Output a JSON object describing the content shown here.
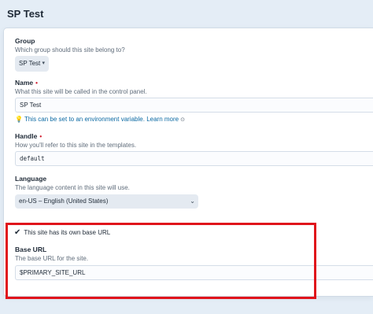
{
  "page": {
    "title": "SP Test"
  },
  "group": {
    "label": "Group",
    "instructions": "Which group should this site belong to?",
    "selected": "SP Test"
  },
  "name": {
    "label": "Name",
    "required_marker": "•",
    "instructions": "What this site will be called in the control panel.",
    "value": "SP Test",
    "hint_text": "This can be set to an environment variable.",
    "hint_link": "Learn more"
  },
  "handle": {
    "label": "Handle",
    "required_marker": "•",
    "instructions": "How you'll refer to this site in the templates.",
    "value": "default"
  },
  "language": {
    "label": "Language",
    "instructions": "The language content in this site will use.",
    "selected": "en-US – English (United States)"
  },
  "base_url_toggle": {
    "label": "This site has its own base URL",
    "checked": true
  },
  "base_url": {
    "label": "Base URL",
    "instructions": "The base URL for the site.",
    "value": "$PRIMARY_SITE_URL"
  },
  "colors": {
    "background": "#e4edf6",
    "required": "#cf1124",
    "link": "#0b69a3",
    "highlight": "#e0141b"
  }
}
